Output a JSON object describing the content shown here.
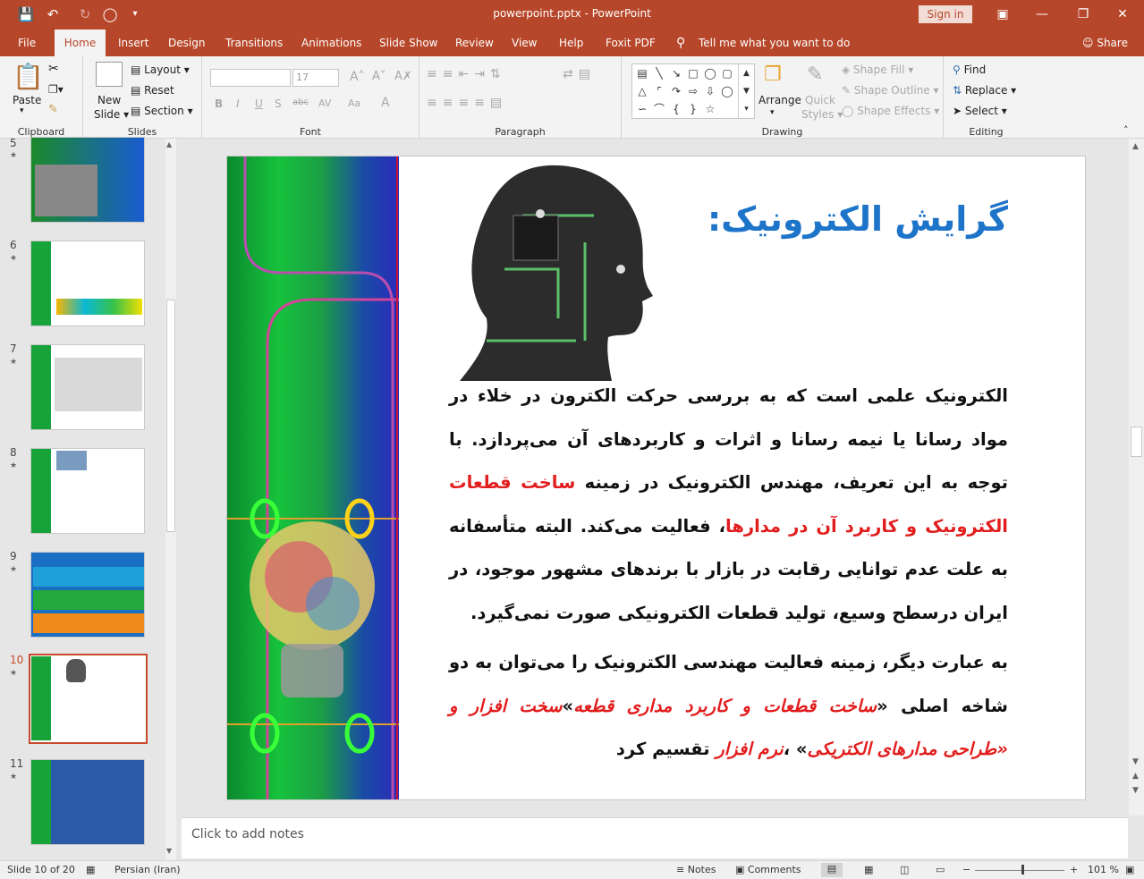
{
  "window": {
    "title": "powerpoint.pptx  -  PowerPoint",
    "signin": "Sign in"
  },
  "tabs": [
    "File",
    "Home",
    "Insert",
    "Design",
    "Transitions",
    "Animations",
    "Slide Show",
    "Review",
    "View",
    "Help",
    "Foxit PDF",
    "Tell me what you want to do",
    "Share"
  ],
  "ribbon": {
    "clipboard": {
      "paste": "Paste",
      "label": "Clipboard"
    },
    "slides": {
      "new_slide": "New",
      "new_slide2": "Slide",
      "layout": "Layout",
      "reset": "Reset",
      "section": "Section",
      "label": "Slides"
    },
    "font": {
      "size": "17",
      "label": "Font",
      "bold": "B",
      "italic": "I",
      "underline": "U",
      "strike": "S",
      "abc": "abc",
      "av": "AV",
      "aa": "Aa",
      "a": "A"
    },
    "paragraph": {
      "label": "Paragraph"
    },
    "drawing": {
      "arrange": "Arrange",
      "quick": "Quick",
      "styles": "Styles",
      "fill": "Shape Fill",
      "outline": "Shape Outline",
      "effects": "Shape Effects",
      "label": "Drawing"
    },
    "editing": {
      "find": "Find",
      "replace": "Replace",
      "select": "Select",
      "label": "Editing"
    }
  },
  "thumbnails": [
    {
      "num": "5"
    },
    {
      "num": "6"
    },
    {
      "num": "7"
    },
    {
      "num": "8"
    },
    {
      "num": "9"
    },
    {
      "num": "10"
    },
    {
      "num": "11"
    }
  ],
  "slide": {
    "title": "گرایش الکترونیک:",
    "p1_a": "الکترونیک علمی است که به بررسی حرکت الکترون در خلاء در مواد رسانا یا نیمه رسانا و اثرات و کاربردهای آن می‌پردازد. با توجه به این تعریف، مهندس الکترونیک در زمینه ",
    "p1_red": "ساخت قطعات الکترونیک و کاربرد آن در مدارها",
    "p1_b": "، فعالیت می‌کند. البته متأسفانه به علت عدم توانایی رقابت در بازار با برندهای مشهور موجود، در ایران درسطح وسیع، تولید قطعات الکترونیکی صورت نمی‌گیرد.",
    "p2_a": "به عبارت دیگر، زمینه فعالیت مهندسی الکترونیک را می‌توان به دو شاخه اصلی «",
    "p2_red1": "ساخت قطعات و کاربرد مداری قطعه",
    "p2_b": "»",
    "p2_red2": "سخت افزار و «طراحی مدارهای الکتریکی",
    "p2_c": "» ،",
    "p2_red3": "نرم افزار",
    "p2_d": " تقسیم کرد"
  },
  "notes": "Click to add notes",
  "status": {
    "slide": "Slide 10 of 20",
    "lang": "Persian (Iran)",
    "notes": "Notes",
    "comments": "Comments",
    "zoom": "101 %"
  },
  "colors": {
    "accent": "#b7472a",
    "title": "#1d74c9",
    "red": "#e21d1d"
  }
}
